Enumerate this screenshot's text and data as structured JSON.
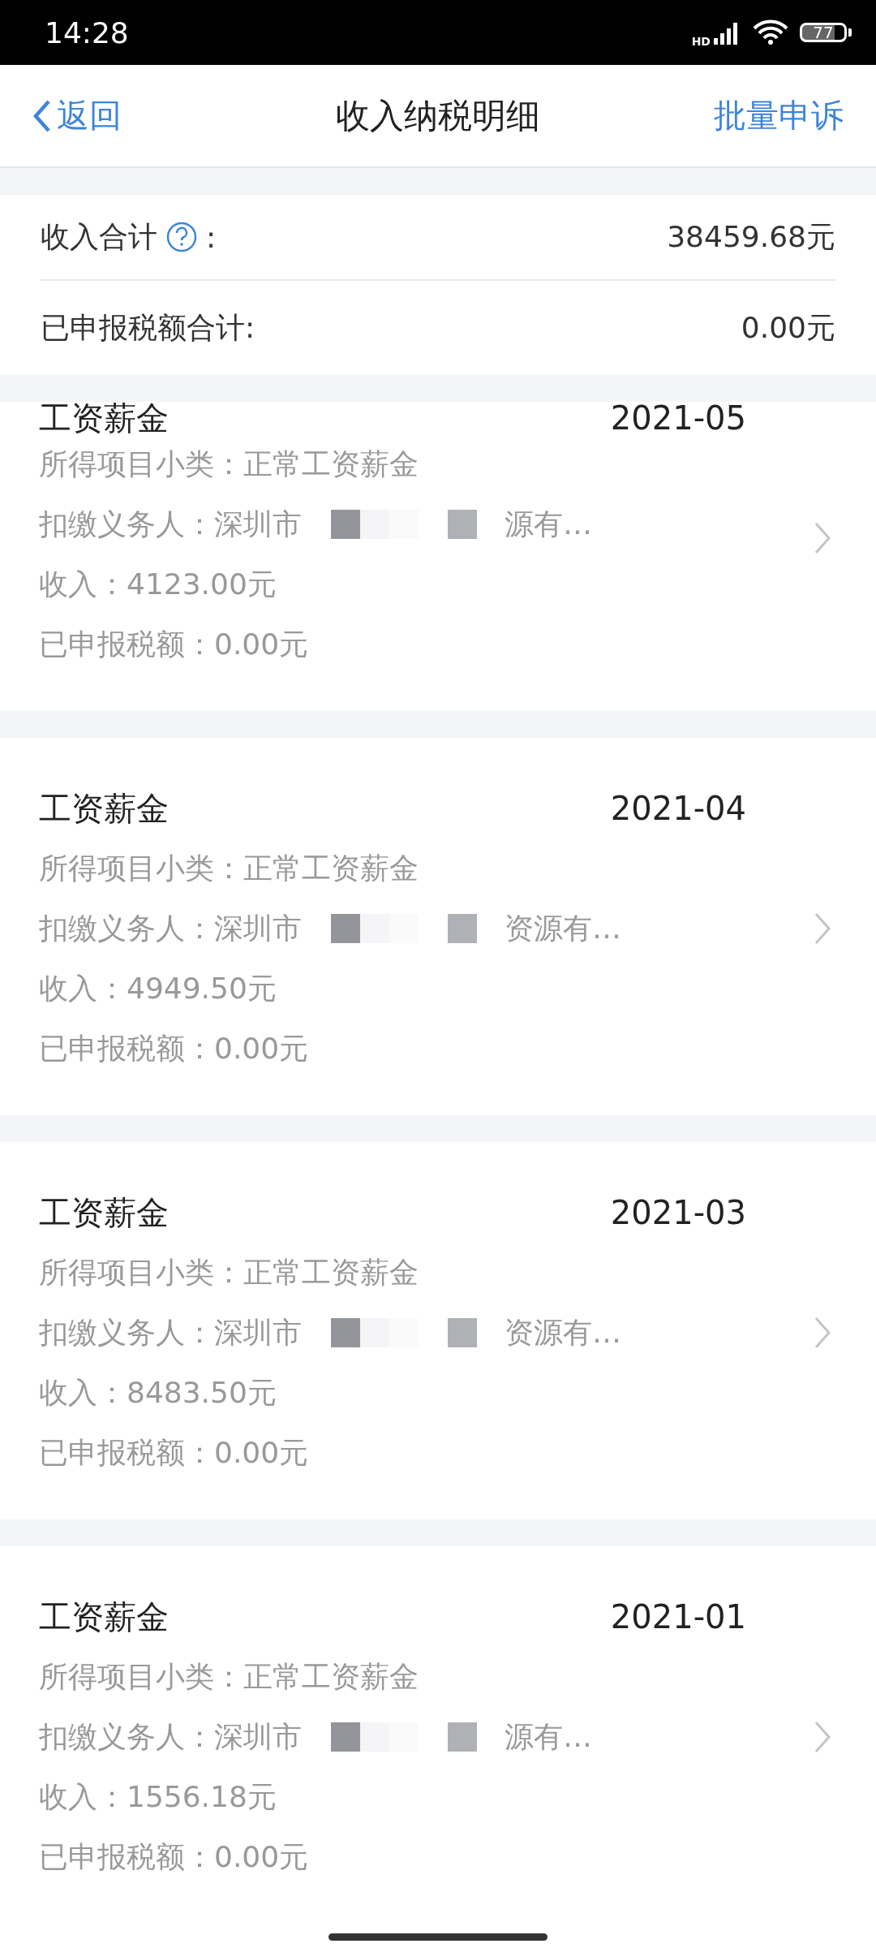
{
  "status_bar": {
    "time": "14:28",
    "network": "HD",
    "battery": "77"
  },
  "nav": {
    "back": "返回",
    "title": "收入纳税明细",
    "action": "批量申诉"
  },
  "summary": [
    {
      "label": "收入合计",
      "help": true,
      "suffix": ":",
      "value": "38459.68元"
    },
    {
      "label": "已申报税额合计:",
      "help": false,
      "value": "0.00元"
    }
  ],
  "records": [
    {
      "category": "工资薪金",
      "period": "2021-05",
      "subclass": "所得项目小类：正常工资薪金",
      "payer_start": "扣缴义务人：深圳市",
      "payer_end": "源有…",
      "income": "收入：4123.00元",
      "tax": "已申报税额：0.00元"
    },
    {
      "category": "工资薪金",
      "period": "2021-04",
      "subclass": "所得项目小类：正常工资薪金",
      "payer_start": "扣缴义务人：深圳市",
      "payer_end": "资源有…",
      "income": "收入：4949.50元",
      "tax": "已申报税额：0.00元"
    },
    {
      "category": "工资薪金",
      "period": "2021-03",
      "subclass": "所得项目小类：正常工资薪金",
      "payer_start": "扣缴义务人：深圳市",
      "payer_end": "资源有…",
      "income": "收入：8483.50元",
      "tax": "已申报税额：0.00元"
    },
    {
      "category": "工资薪金",
      "period": "2021-01",
      "subclass": "所得项目小类：正常工资薪金",
      "payer_start": "扣缴义务人：深圳市",
      "payer_end": "源有…",
      "income": "收入：1556.18元",
      "tax": "已申报税额：0.00元"
    }
  ]
}
